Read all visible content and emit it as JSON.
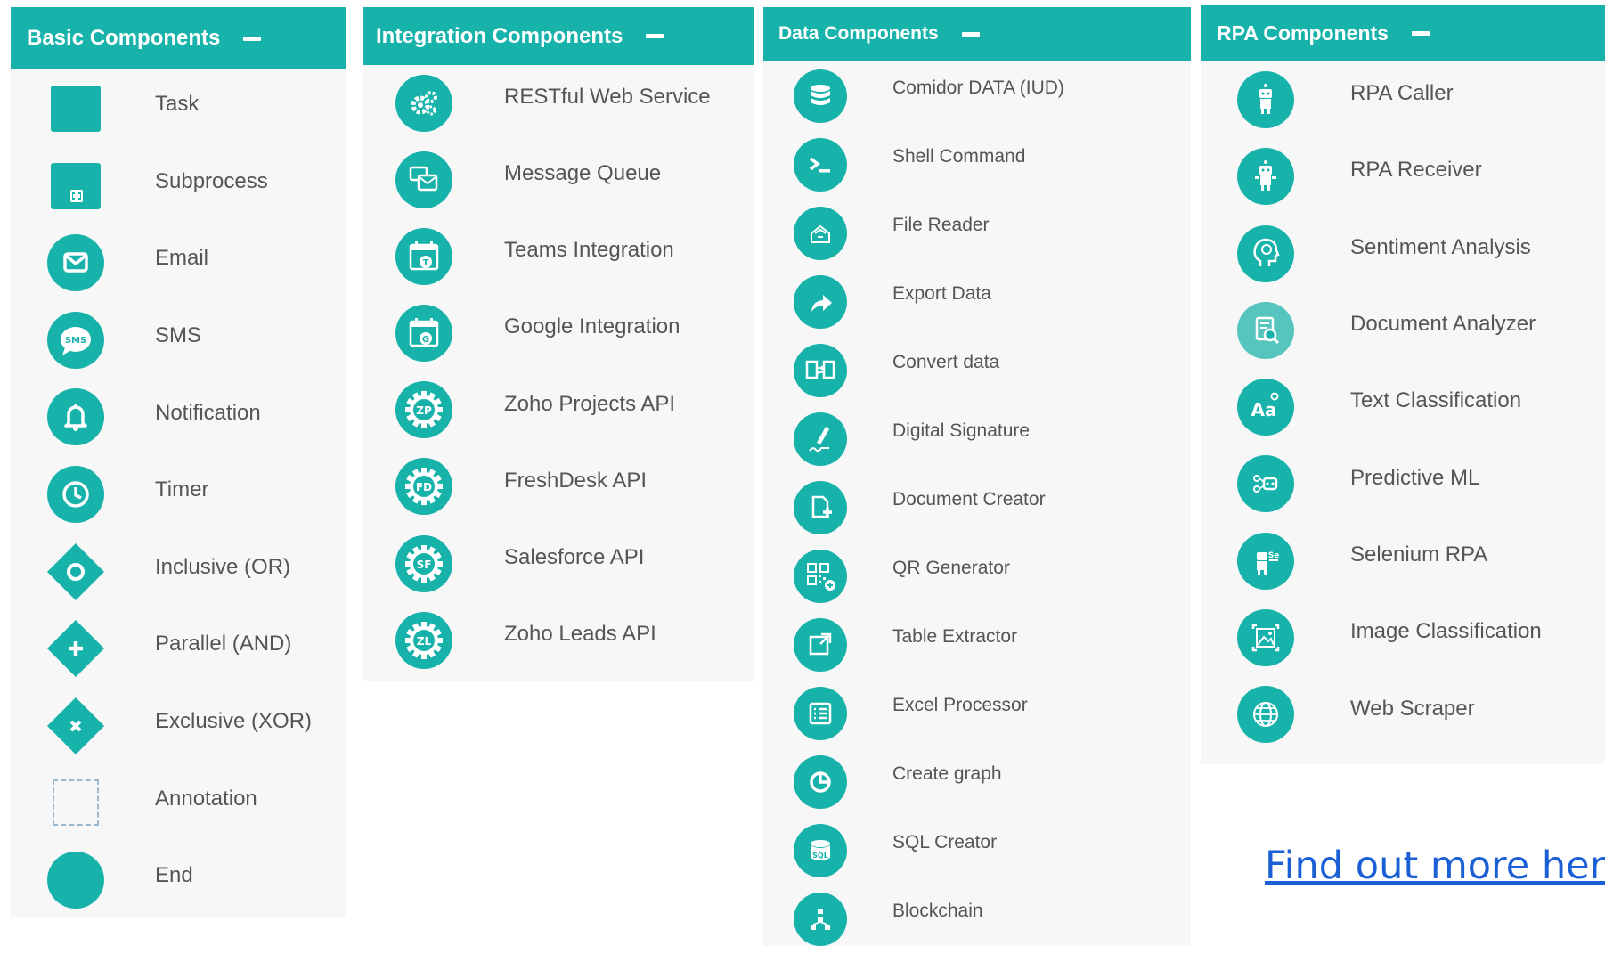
{
  "panels": {
    "basic": {
      "title": "Basic Components",
      "items": [
        "Task",
        "Subprocess",
        "Email",
        "SMS",
        "Notification",
        "Timer",
        "Inclusive (OR)",
        "Parallel (AND)",
        "Exclusive (XOR)",
        "Annotation",
        "End"
      ],
      "icons": [
        "square-icon",
        "subprocess-icon",
        "envelope-icon",
        "sms-bubble-icon",
        "bell-icon",
        "clock-icon",
        "inclusive-gateway-icon",
        "parallel-gateway-icon",
        "exclusive-gateway-icon",
        "dashed-square-icon",
        "end-circle-icon"
      ]
    },
    "integration": {
      "title": "Integration Components",
      "items": [
        "RESTful Web Service",
        "Message Queue",
        "Teams Integration",
        "Google Integration",
        "Zoho Projects API",
        "FreshDesk API",
        "Salesforce API",
        "Zoho Leads API"
      ],
      "icons": [
        "gears-icon",
        "message-queue-icon",
        "teams-calendar-icon",
        "google-calendar-icon",
        "zoho-projects-gear-icon",
        "freshdesk-gear-icon",
        "salesforce-gear-icon",
        "zoho-leads-gear-icon"
      ],
      "gear_text": [
        "ZP",
        "FD",
        "SF",
        "ZL"
      ]
    },
    "data": {
      "title": "Data Components",
      "items": [
        "Comidor DATA (IUD)",
        "Shell Command",
        "File Reader",
        "Export Data",
        "Convert data",
        "Digital Signature",
        "Document Creator",
        "QR Generator",
        "Table Extractor",
        "Excel Processor",
        "Create graph",
        "SQL Creator",
        "Blockchain"
      ],
      "icons": [
        "database-icon",
        "terminal-icon",
        "file-reader-icon",
        "share-arrow-icon",
        "convert-document-icon",
        "signature-pen-icon",
        "new-document-icon",
        "qr-code-icon",
        "table-extract-icon",
        "list-icon",
        "pie-chart-icon",
        "sql-icon",
        "blockchain-icon"
      ]
    },
    "rpa": {
      "title": "RPA Components",
      "items": [
        "RPA Caller",
        "RPA Receiver",
        "Sentiment Analysis",
        "Document Analyzer",
        "Text Classification",
        "Predictive ML",
        "Selenium RPA",
        "Image Classification",
        "Web Scraper"
      ],
      "icons": [
        "robot-icon",
        "robot-receiver-icon",
        "ai-head-icon",
        "document-analyzer-icon",
        "text-classification-icon",
        "predictive-ml-icon",
        "selenium-robot-icon",
        "image-classification-icon",
        "web-scraper-icon"
      ]
    }
  },
  "footer": {
    "link_text": "Find out more here."
  },
  "colors": {
    "accent": "#17b3ab",
    "panel_bg": "#f7f7f7",
    "label": "#555555",
    "link": "#1a5fd6"
  }
}
